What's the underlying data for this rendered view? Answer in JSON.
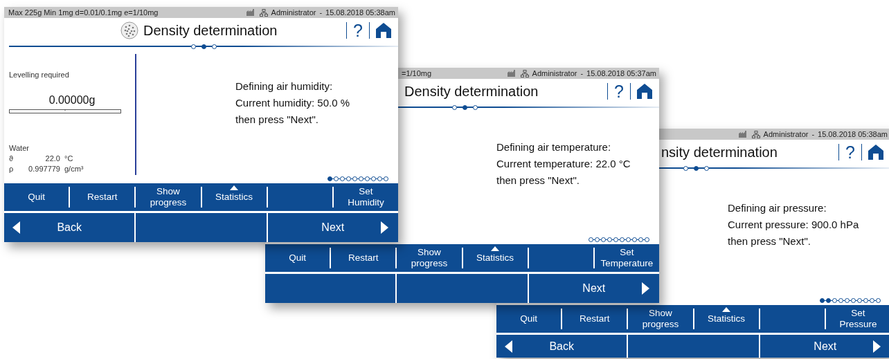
{
  "windows": [
    {
      "status": {
        "left": "Max 225g  Min 1mg  d=0.01/0.1mg  e=1/10mg",
        "user": "Administrator",
        "separator": "-",
        "datetime": "15.08.2018 05:38am"
      },
      "title": "Density determination",
      "help": "?",
      "steps": [
        {
          "filled": false
        },
        {
          "filled": true
        },
        {
          "filled": false
        }
      ],
      "side_panel": {
        "notice": "Levelling required",
        "weight": "0.00000g",
        "liquid": "Water",
        "readings": [
          {
            "symbol": "ϑ",
            "value": "22.0",
            "unit": "°C"
          },
          {
            "symbol": "ρ",
            "value": "0.997779",
            "unit": "g/cm³"
          }
        ]
      },
      "message": [
        "Defining air humidity:",
        "Current humidity: 50.0 %",
        "then press \"Next\"."
      ],
      "page_dots": [
        {
          "filled": true
        },
        {
          "filled": false
        },
        {
          "filled": false
        },
        {
          "filled": false
        },
        {
          "filled": false
        },
        {
          "filled": false
        },
        {
          "filled": false
        },
        {
          "filled": false
        },
        {
          "filled": false
        },
        {
          "filled": false
        }
      ],
      "function_keys": [
        {
          "kind": "plain",
          "label": "Quit"
        },
        {
          "kind": "plain",
          "label": "Restart"
        },
        {
          "kind": "plain",
          "label": "Show\nprogress"
        },
        {
          "kind": "menu",
          "label": "Statistics"
        },
        {
          "kind": "empty"
        },
        {
          "kind": "plain",
          "label": "Set\nHumidity"
        }
      ],
      "nav_keys": [
        {
          "kind": "back",
          "label": "Back"
        },
        {
          "kind": "empty"
        },
        {
          "kind": "next",
          "label": "Next"
        }
      ]
    },
    {
      "status": {
        "left": "=1/10mg",
        "user": "Administrator",
        "separator": "-",
        "datetime": "15.08.2018 05:37am"
      },
      "title": "Density determination",
      "help": "?",
      "steps": [
        {
          "filled": false
        },
        {
          "filled": true
        },
        {
          "filled": false
        }
      ],
      "message": [
        "Defining air temperature:",
        "Current temperature: 22.0 °C",
        "then press \"Next\"."
      ],
      "page_dots": [
        {
          "filled": false
        },
        {
          "filled": false
        },
        {
          "filled": false
        },
        {
          "filled": false
        },
        {
          "filled": false
        },
        {
          "filled": false
        },
        {
          "filled": false
        },
        {
          "filled": false
        },
        {
          "filled": false
        },
        {
          "filled": false
        }
      ],
      "function_keys": [
        {
          "kind": "plain",
          "label": "Quit"
        },
        {
          "kind": "plain",
          "label": "Restart"
        },
        {
          "kind": "plain",
          "label": "Show\nprogress"
        },
        {
          "kind": "menu",
          "label": "Statistics"
        },
        {
          "kind": "empty"
        },
        {
          "kind": "plain",
          "label": "Set\nTemperature"
        }
      ],
      "nav_keys": [
        {
          "kind": "empty"
        },
        {
          "kind": "empty"
        },
        {
          "kind": "next",
          "label": "Next"
        }
      ]
    },
    {
      "status": {
        "user": "Administrator",
        "separator": "-",
        "datetime": "15.08.2018 05:38am"
      },
      "title": "nsity determination",
      "help": "?",
      "steps": [
        {
          "filled": false
        },
        {
          "filled": true
        },
        {
          "filled": false
        }
      ],
      "message": [
        "Defining air pressure:",
        "Current pressure: 900.0 hPa",
        "then press \"Next\"."
      ],
      "page_dots": [
        {
          "filled": true
        },
        {
          "filled": true
        },
        {
          "filled": false
        },
        {
          "filled": false
        },
        {
          "filled": false
        },
        {
          "filled": false
        },
        {
          "filled": false
        },
        {
          "filled": false
        },
        {
          "filled": false
        },
        {
          "filled": false
        }
      ],
      "function_keys": [
        {
          "kind": "plain",
          "label": "Quit"
        },
        {
          "kind": "plain",
          "label": "Restart"
        },
        {
          "kind": "plain",
          "label": "Show\nprogress"
        },
        {
          "kind": "menu",
          "label": "Statistics"
        },
        {
          "kind": "empty"
        },
        {
          "kind": "plain",
          "label": "Set\nPressure"
        }
      ],
      "nav_keys": [
        {
          "kind": "back",
          "label": "Back"
        },
        {
          "kind": "empty"
        },
        {
          "kind": "next",
          "label": "Next"
        }
      ]
    }
  ]
}
